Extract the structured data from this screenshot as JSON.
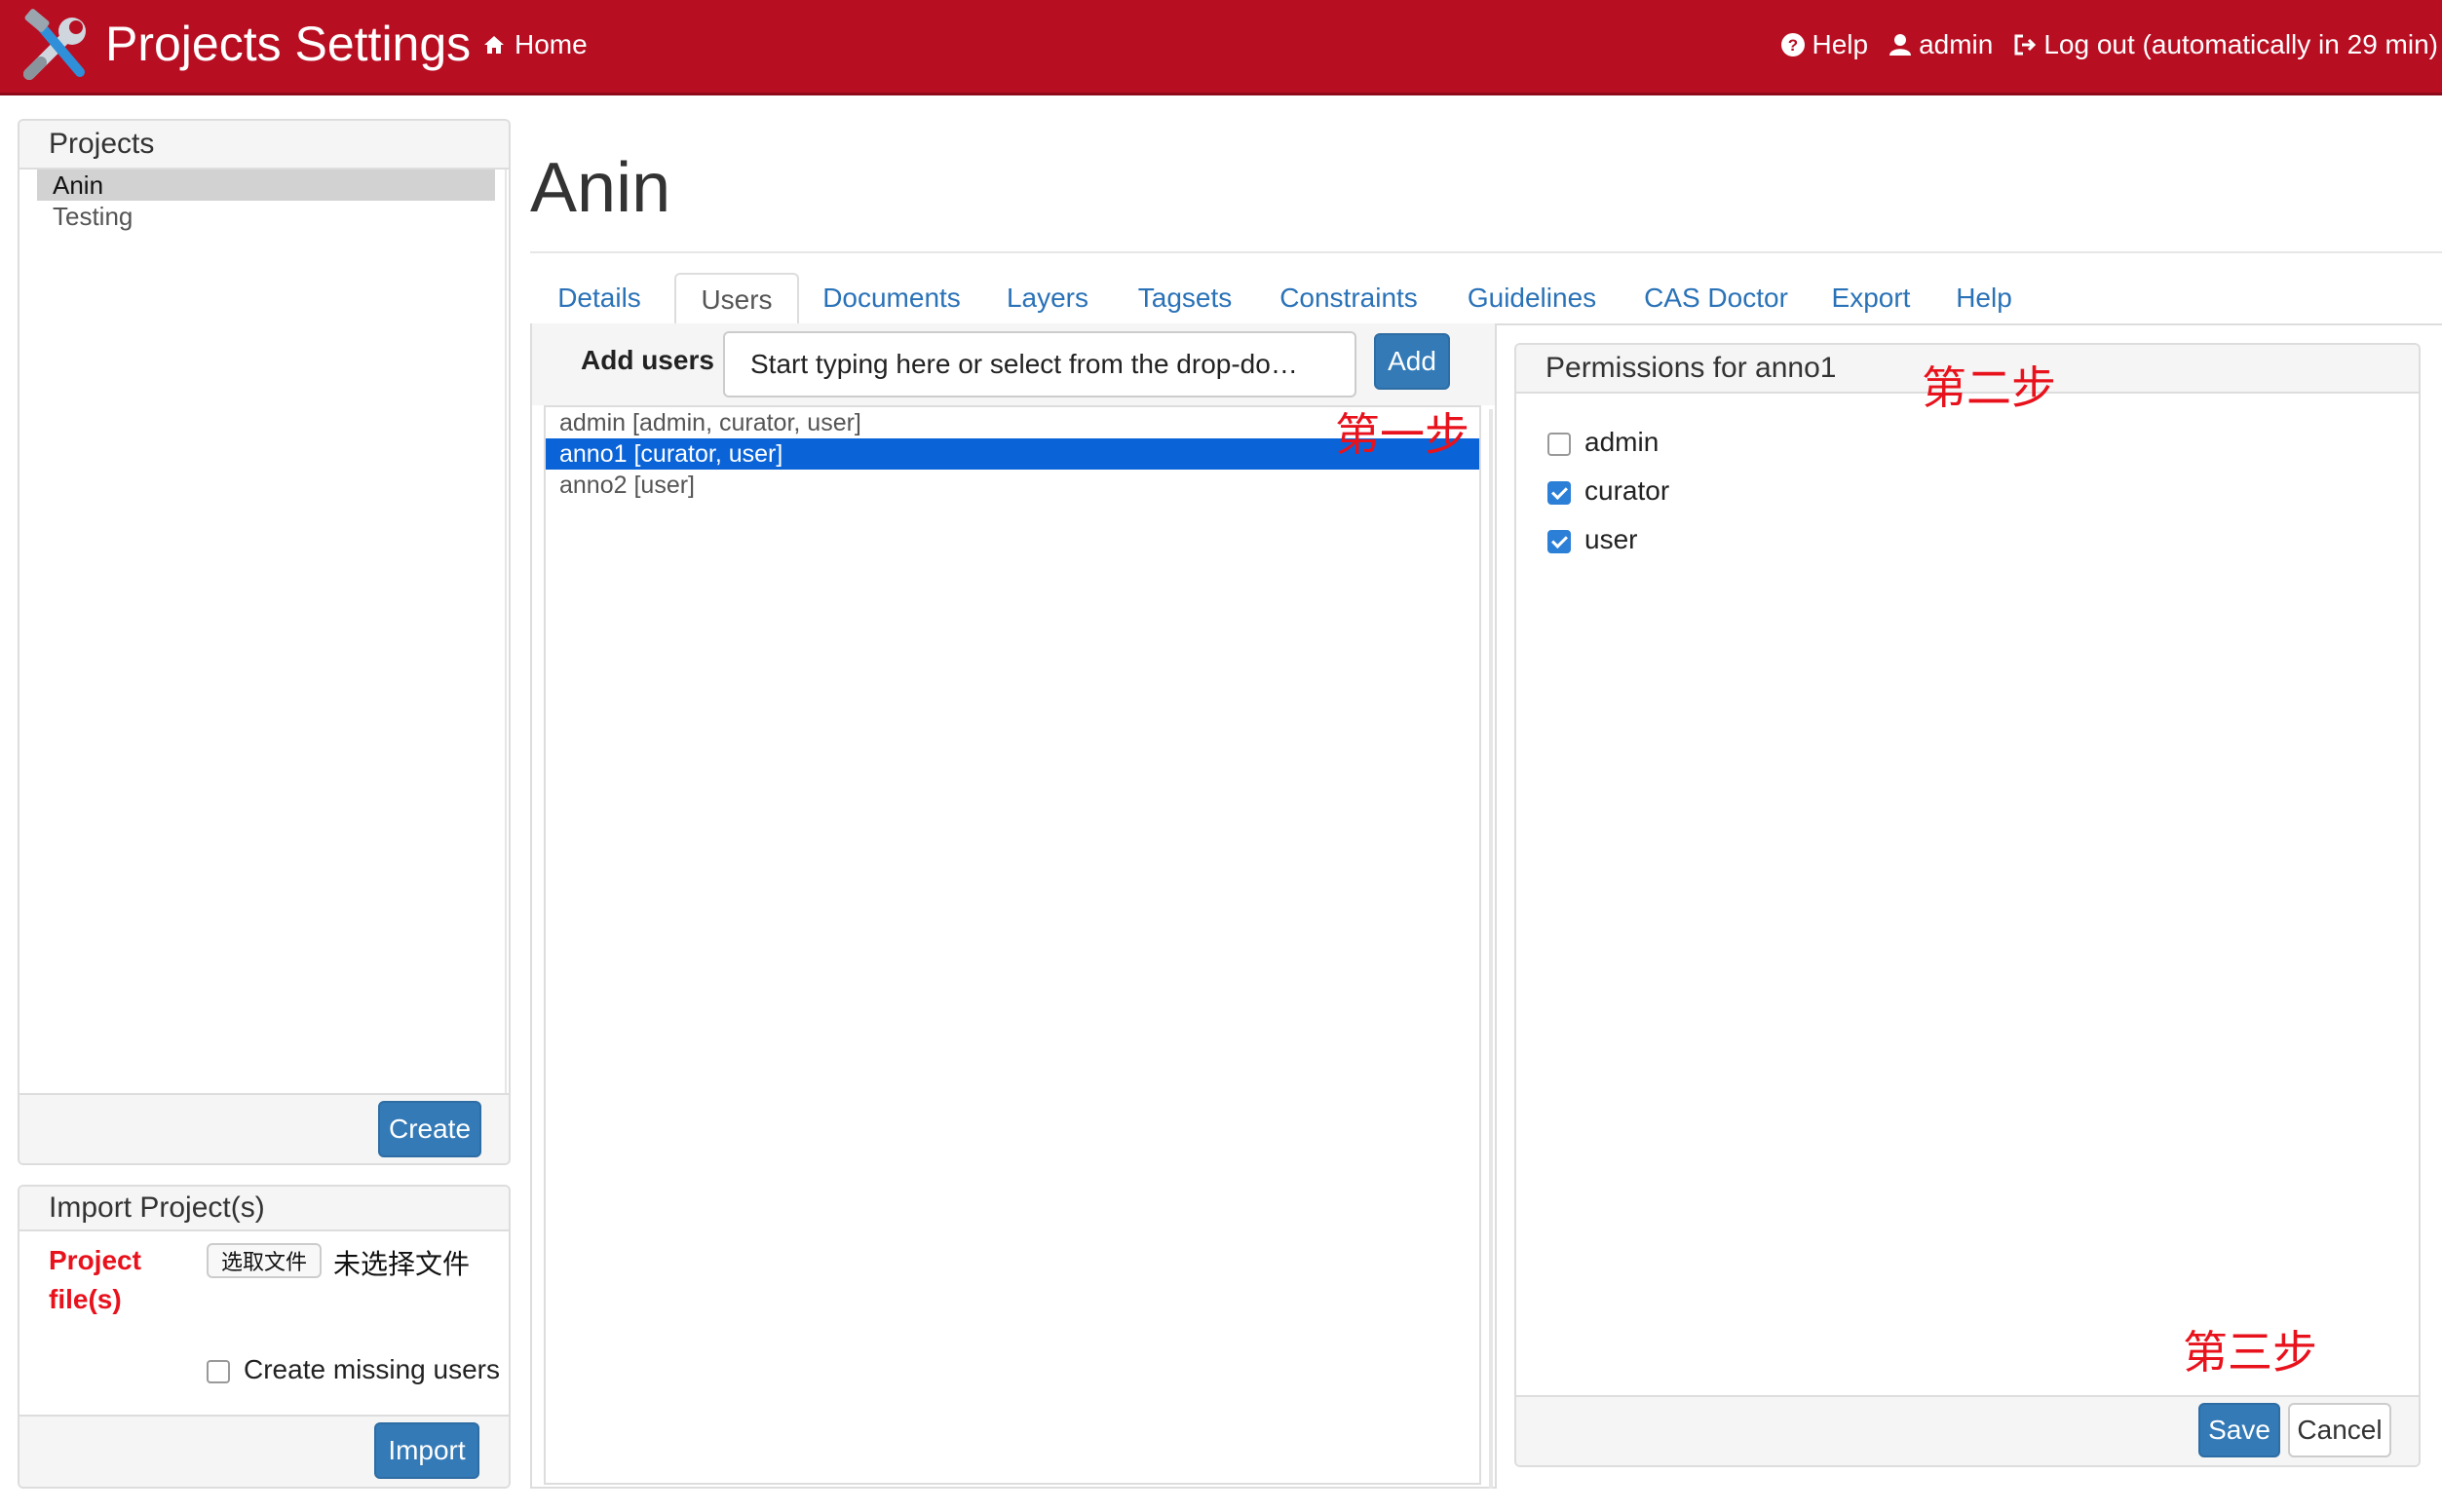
{
  "navbar": {
    "title": "Projects Settings",
    "home": "Home",
    "help": "Help",
    "user": "admin",
    "logout": "Log out (automatically in 29 min)",
    "brand_color": "#b80e22"
  },
  "projects_panel": {
    "title": "Projects",
    "items": [
      "Anin",
      "Testing"
    ],
    "selected": "Anin",
    "create_label": "Create"
  },
  "import_panel": {
    "title": "Import Project(s)",
    "file_label": "Project file(s)",
    "choose_file_label": "选取文件",
    "no_file_text": "未选择文件",
    "create_missing_users_label": "Create missing users",
    "create_missing_users_checked": false,
    "import_label": "Import"
  },
  "page": {
    "title": "Anin"
  },
  "tabs": [
    "Details",
    "Users",
    "Documents",
    "Layers",
    "Tagsets",
    "Constraints",
    "Guidelines",
    "CAS Doctor",
    "Export",
    "Help"
  ],
  "active_tab": "Users",
  "users": {
    "add_label": "Add users",
    "add_placeholder": "Start typing here or select from the drop-do…",
    "add_button": "Add",
    "list": [
      "admin [admin, curator, user]",
      "anno1 [curator, user]",
      "anno2 [user]"
    ],
    "selected": "anno1 [curator, user]"
  },
  "permissions": {
    "title": "Permissions for anno1",
    "roles": [
      {
        "label": "admin",
        "checked": false
      },
      {
        "label": "curator",
        "checked": true
      },
      {
        "label": "user",
        "checked": true
      }
    ],
    "save_label": "Save",
    "cancel_label": "Cancel"
  },
  "annotations": {
    "step1": "第一步",
    "step2": "第二步",
    "step3": "第三步"
  }
}
